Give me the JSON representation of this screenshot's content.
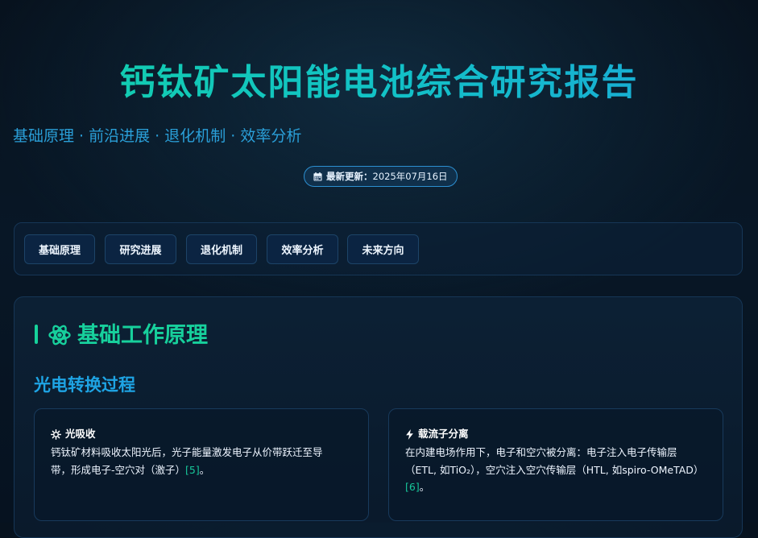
{
  "header": {
    "title": "钙钛矿太阳能电池综合研究报告",
    "subtitle": "基础原理 · 前沿进展 · 退化机制 · 效率分析",
    "badge_prefix": "最新更新：",
    "badge_date": "2025年07月16日",
    "badge_icon": "calendar-icon"
  },
  "nav": {
    "items": [
      {
        "label": "基础原理"
      },
      {
        "label": "研究进展"
      },
      {
        "label": "退化机制"
      },
      {
        "label": "效率分析"
      },
      {
        "label": "未来方向"
      }
    ]
  },
  "section": {
    "icon": "atom-icon",
    "title": "基础工作原理",
    "subheading": "光电转换过程",
    "cards": [
      {
        "icon": "sun-icon",
        "title": "光吸收",
        "text_line1": "钙钛矿材料吸收太阳光后，光子能量激发电子从价带跃迁至导",
        "text_line2": "带，形成电子-空穴对（激子）",
        "ref": "[5]",
        "tail": "。"
      },
      {
        "icon": "bolt-icon",
        "title": "载流子分离",
        "text_line1": "在内建电场作用下，电子和空穴被分离：电子注入电子传输层",
        "text_line2": "（ETL, 如TiO₂），空穴注入空穴传输层（HTL, 如spiro-OMeTAD）",
        "ref": "[6]",
        "tail": "。"
      }
    ]
  },
  "colors": {
    "accent_green": "#16d29b",
    "accent_blue": "#1ea4e4",
    "background": "#07121e"
  }
}
